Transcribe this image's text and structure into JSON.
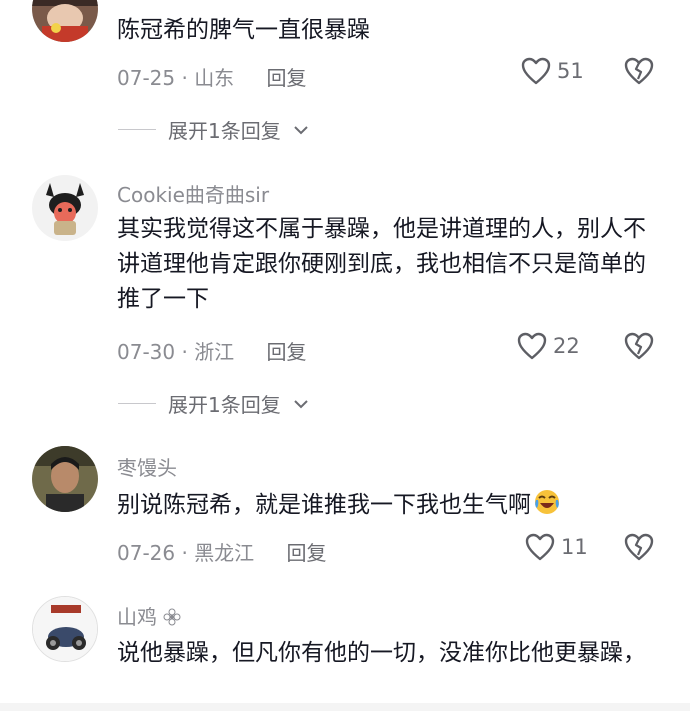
{
  "comments": [
    {
      "text": "陈冠希的脾气一直很暴躁",
      "date_location": "07-25 · 山东",
      "reply_label": "回复",
      "likes": "51",
      "expand_label": "展开1条回复"
    },
    {
      "username": "Cookie曲奇曲sir",
      "text": "其实我觉得这不属于暴躁，他是讲道理的人，别人不讲道理他肯定跟你硬刚到底，我也相信不只是简单的推了一下",
      "date_location": "07-30 · 浙江",
      "reply_label": "回复",
      "likes": "22",
      "expand_label": "展开1条回复"
    },
    {
      "username": "枣馒头",
      "text": "别说陈冠希，就是谁推我一下我也生气啊",
      "date_location": "07-26 · 黑龙江",
      "reply_label": "回复",
      "likes": "11"
    },
    {
      "username": "山鸡",
      "text": "说他暴躁，但凡你有他的一切，没准你比他更暴躁，"
    }
  ],
  "icons": {
    "like": "heart-outline-icon",
    "dislike": "broken-heart-icon",
    "expand": "chevron-down-icon",
    "emoji": "crying-laughing-emoji"
  },
  "colors": {
    "text": "#161823",
    "meta": "#8a8b91",
    "background": "#ffffff"
  }
}
